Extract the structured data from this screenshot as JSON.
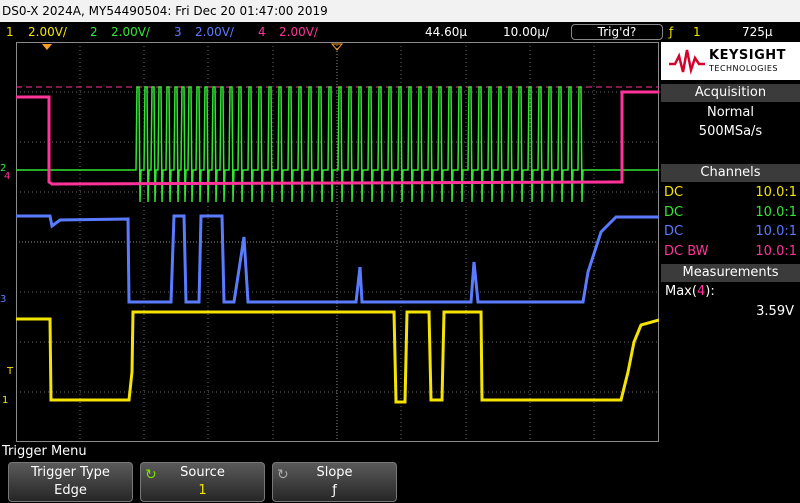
{
  "title_bar": {
    "text": "DS0-X 2024A, MY54490504: Fri Dec 20 01:47:00 2019"
  },
  "status_bar": {
    "ch1": {
      "num": "1",
      "scale": "2.00V/",
      "color": "#f5e400"
    },
    "ch2": {
      "num": "2",
      "scale": "2.00V/",
      "color": "#33e633"
    },
    "ch3": {
      "num": "3",
      "scale": "2.00V/",
      "color": "#5b7bff"
    },
    "ch4": {
      "num": "4",
      "scale": "2.00V/",
      "color": "#ff3399"
    },
    "time_position": "44.60µ",
    "time_scale": "10.00µ/",
    "trigger_status": "Trig'd?",
    "trigger_slope_glyph": "ƒ",
    "trigger_source": "1",
    "trigger_level": "725µ"
  },
  "brand": {
    "name": "KEYSIGHT",
    "sub": "TECHNOLOGIES",
    "accent": "#d2042d"
  },
  "acquisition": {
    "header": "Acquisition",
    "mode": "Normal",
    "rate": "500MSa/s"
  },
  "channels": {
    "header": "Channels",
    "rows": [
      {
        "coupling": "DC",
        "probe": "10.0:1",
        "color": "#f5e400"
      },
      {
        "coupling": "DC",
        "probe": "10.0:1",
        "color": "#33e633"
      },
      {
        "coupling": "DC",
        "probe": "10.0:1",
        "color": "#5b7bff"
      },
      {
        "coupling": "DC BW",
        "probe": "10.0:1",
        "color": "#ff3399"
      }
    ]
  },
  "measurements": {
    "header": "Measurements",
    "label": "Max",
    "channel": "4",
    "label_suffix": "):",
    "label_open": "(",
    "value": "3.59V"
  },
  "trigger_menu": {
    "title": "Trigger Menu",
    "softkeys": [
      {
        "label": "Trigger Type",
        "value": "Edge"
      },
      {
        "label": "Source",
        "value": "1"
      },
      {
        "label": "Slope",
        "value": "ƒ"
      }
    ]
  },
  "markers": {
    "ch1": "1",
    "ch2": "2",
    "ch3": "3",
    "ch4": "4",
    "trigger": "T"
  }
}
